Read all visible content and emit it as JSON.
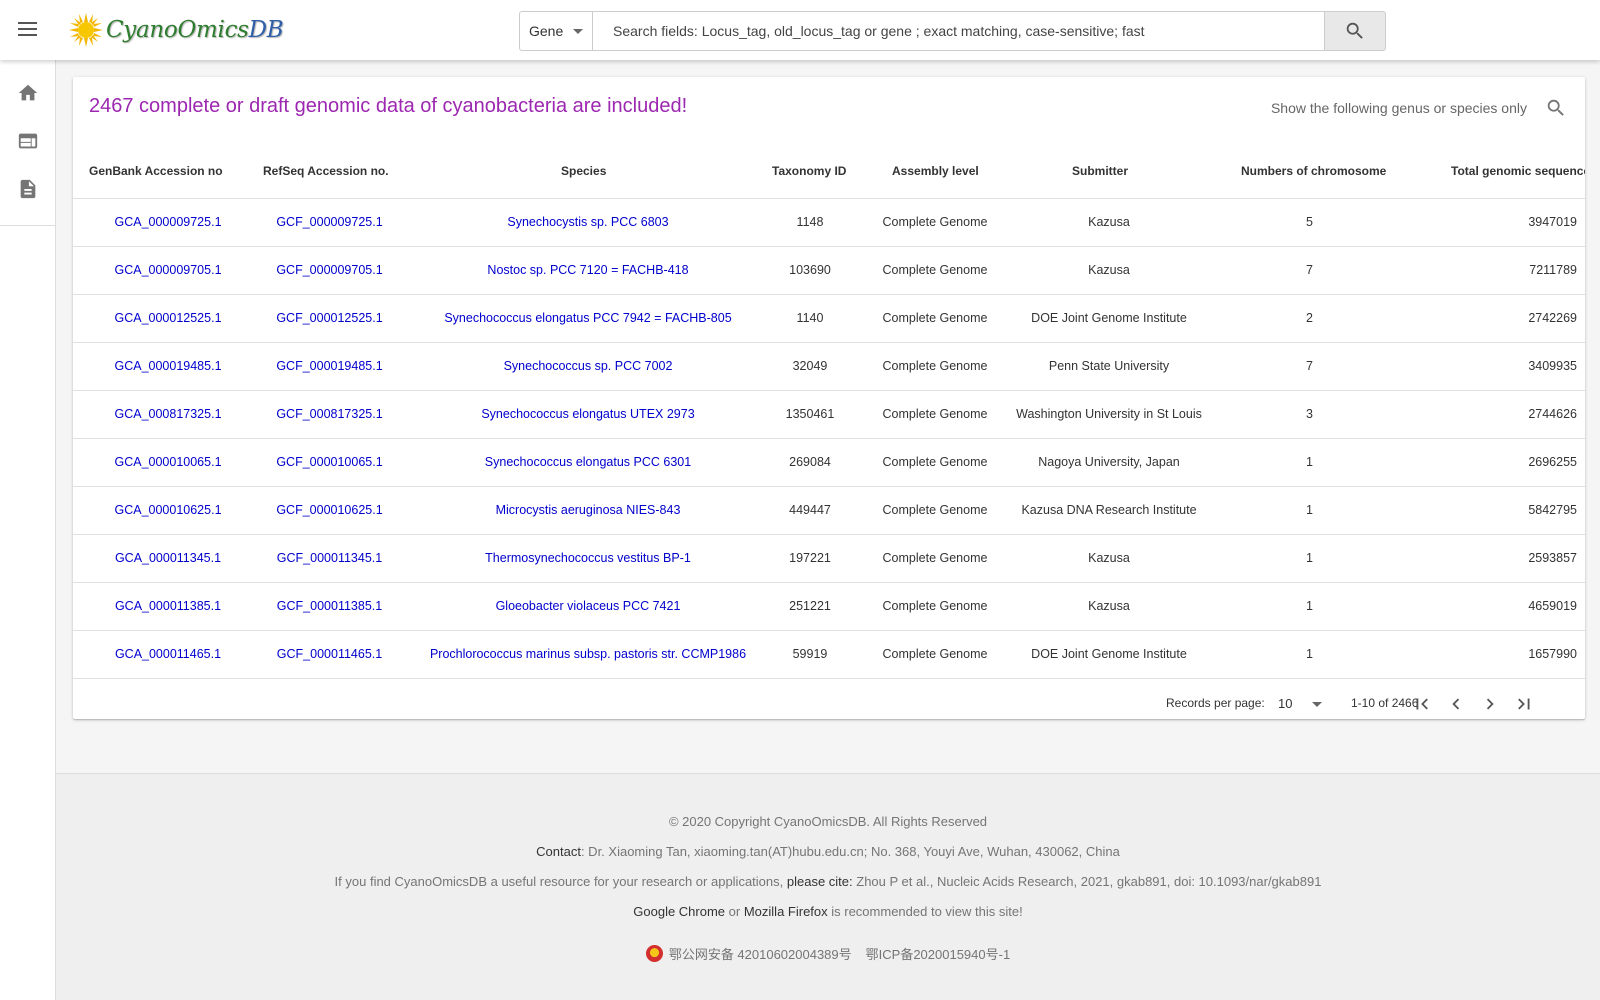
{
  "header": {
    "logo_text_main": "CyanoOmics",
    "logo_text_db": "DB",
    "search_type": "Gene",
    "search_placeholder": "Search fields: Locus_tag, old_locus_tag or gene ; exact matching, case-sensitive; fast"
  },
  "sidebar": {
    "items": [
      {
        "icon": "home-icon"
      },
      {
        "icon": "browser-window-icon"
      },
      {
        "icon": "document-icon"
      }
    ]
  },
  "main": {
    "title": "2467 complete or draft genomic data of cyanobacteria are included!",
    "filter_label": "Show the following genus or species only",
    "columns": [
      "GenBank Accession no",
      "RefSeq Accession no.",
      "Species",
      "Taxonomy ID",
      "Assembly level",
      "Submitter",
      "Numbers of chromosome",
      "Total genomic sequence length"
    ],
    "rows": [
      [
        "GCA_000009725.1",
        "GCF_000009725.1",
        "Synechocystis sp. PCC 6803",
        "1148",
        "Complete Genome",
        "Kazusa",
        "5",
        "3947019"
      ],
      [
        "GCA_000009705.1",
        "GCF_000009705.1",
        "Nostoc sp. PCC 7120 = FACHB-418",
        "103690",
        "Complete Genome",
        "Kazusa",
        "7",
        "7211789"
      ],
      [
        "GCA_000012525.1",
        "GCF_000012525.1",
        "Synechococcus elongatus PCC 7942 = FACHB-805",
        "1140",
        "Complete Genome",
        "DOE Joint Genome Institute",
        "2",
        "2742269"
      ],
      [
        "GCA_000019485.1",
        "GCF_000019485.1",
        "Synechococcus sp. PCC 7002",
        "32049",
        "Complete Genome",
        "Penn State University",
        "7",
        "3409935"
      ],
      [
        "GCA_000817325.1",
        "GCF_000817325.1",
        "Synechococcus elongatus UTEX 2973",
        "1350461",
        "Complete Genome",
        "Washington University in St Louis",
        "3",
        "2744626"
      ],
      [
        "GCA_000010065.1",
        "GCF_000010065.1",
        "Synechococcus elongatus PCC 6301",
        "269084",
        "Complete Genome",
        "Nagoya University, Japan",
        "1",
        "2696255"
      ],
      [
        "GCA_000010625.1",
        "GCF_000010625.1",
        "Microcystis aeruginosa NIES-843",
        "449447",
        "Complete Genome",
        "Kazusa DNA Research Institute",
        "1",
        "5842795"
      ],
      [
        "GCA_000011345.1",
        "GCF_000011345.1",
        "Thermosynechococcus vestitus BP-1",
        "197221",
        "Complete Genome",
        "Kazusa",
        "1",
        "2593857"
      ],
      [
        "GCA_000011385.1",
        "GCF_000011385.1",
        "Gloeobacter violaceus PCC 7421",
        "251221",
        "Complete Genome",
        "Kazusa",
        "1",
        "4659019"
      ],
      [
        "GCA_000011465.1",
        "GCF_000011465.1",
        "Prochlorococcus marinus subsp. pastoris str. CCMP1986",
        "59919",
        "Complete Genome",
        "DOE Joint Genome Institute",
        "1",
        "1657990"
      ]
    ],
    "pagination": {
      "records_label": "Records per page:",
      "per_page": "10",
      "range": "1-10 of 2466"
    }
  },
  "footer": {
    "copyright": "© 2020 Copyright CyanoOmicsDB. All Rights Reserved",
    "contact_label": "Contact",
    "contact_text": ": Dr. Xiaoming Tan, xiaoming.tan(AT)hubu.edu.cn; No. 368, Youyi Ave, Wuhan, 430062, China",
    "cite_prefix": "If you find CyanoOmicsDB a useful resource for your research or applications, ",
    "cite_label": "please cite:",
    "cite_text": " Zhou P et al., Nucleic Acids Research, 2021, gkab891, doi: 10.1093/nar/gkab891",
    "browser_chrome": "Google Chrome",
    "browser_or": " or ",
    "browser_firefox": "Mozilla Firefox",
    "browser_suffix": " is recommended to view this site!",
    "police_record": "鄂公网安备 42010602004389号",
    "icp_record": "鄂ICP备2020015940号-1"
  },
  "colors": {
    "title": "#9c27b0",
    "link": "#0000cd",
    "logo_green": "#2e7d2e",
    "logo_blue": "#2f5fa8"
  }
}
